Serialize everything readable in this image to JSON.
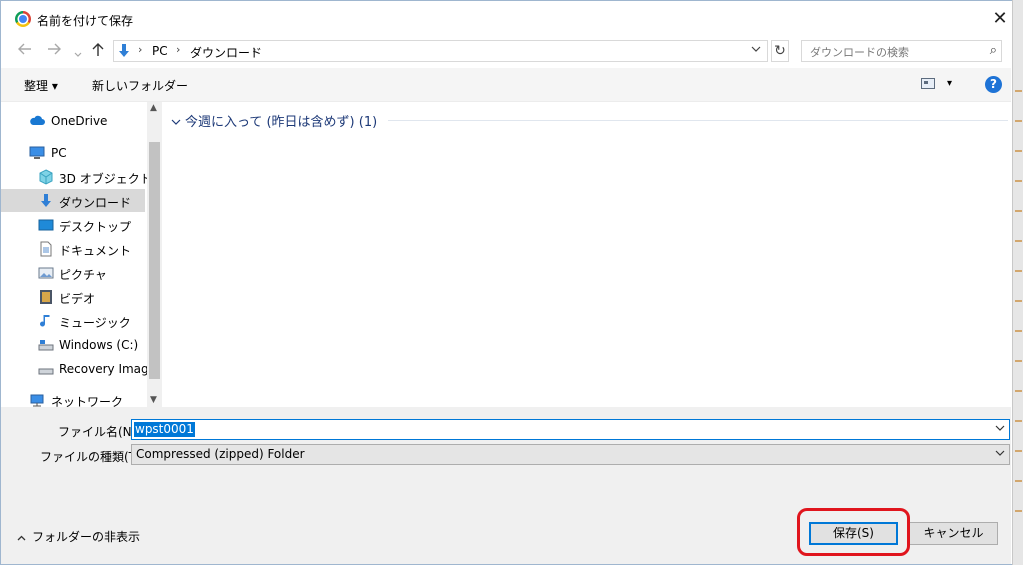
{
  "window": {
    "title": "名前を付けて保存",
    "app_icon": "chrome-icon",
    "close_glyph": "✕"
  },
  "nav": {
    "back_icon": "arrow-left-icon",
    "forward_icon": "arrow-right-icon",
    "recent_icon": "chevron-down-icon",
    "up_icon": "arrow-up-icon",
    "breadcrumb": [
      "PC",
      "ダウンロード"
    ],
    "search_placeholder": "ダウンロードの検索"
  },
  "toolbar": {
    "organize_label": "整理 ▾",
    "new_folder_label": "新しいフォルダー",
    "help_label": "?"
  },
  "sidebar": {
    "items": [
      {
        "label": "OneDrive",
        "icon": "cloud-icon"
      },
      {
        "label": "PC",
        "icon": "computer-icon"
      },
      {
        "label": "3D オブジェクト",
        "icon": "cube-icon"
      },
      {
        "label": "ダウンロード",
        "icon": "download-icon",
        "selected": true
      },
      {
        "label": "デスクトップ",
        "icon": "desktop-icon"
      },
      {
        "label": "ドキュメント",
        "icon": "document-icon"
      },
      {
        "label": "ピクチャ",
        "icon": "picture-icon"
      },
      {
        "label": "ビデオ",
        "icon": "video-icon"
      },
      {
        "label": "ミュージック",
        "icon": "music-icon"
      },
      {
        "label": "Windows (C:)",
        "icon": "drive-icon"
      },
      {
        "label": "Recovery Image",
        "icon": "drive-icon"
      },
      {
        "label": "ネットワーク",
        "icon": "network-icon"
      }
    ]
  },
  "content": {
    "group_header": "今週に入って (昨日は含めず) (1)"
  },
  "form": {
    "filename_label": "ファイル名(N):",
    "filename_value": "wpst0001",
    "filetype_label": "ファイルの種類(T):",
    "filetype_value": "Compressed (zipped) Folder",
    "hide_folders_label": "フォルダーの非表示",
    "save_label": "保存(S)",
    "cancel_label": "キャンセル"
  },
  "colors": {
    "accent": "#0078d7",
    "callout": "#e0151d",
    "group_header": "#1e3a78"
  }
}
